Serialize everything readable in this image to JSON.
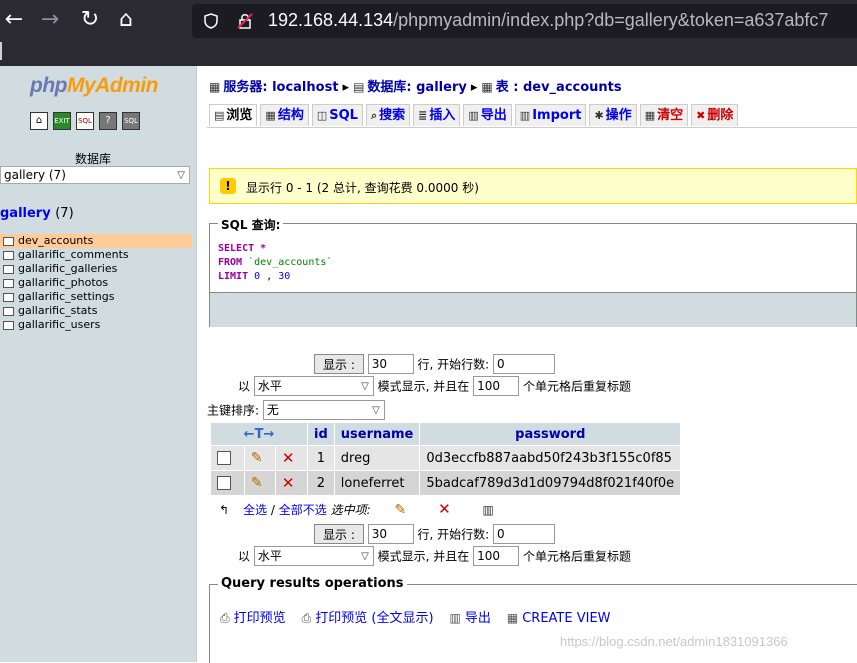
{
  "browser": {
    "back_icon": "←",
    "forward_icon": "→",
    "reload_icon": "↻",
    "home_icon": "⌂",
    "url_host": "192.168.44.134",
    "url_path": "/phpmyadmin/index.php?db=gallery&token=a637abfc7"
  },
  "sidebar": {
    "logo_php": "php",
    "logo_my": "My",
    "logo_admin": "Admin",
    "db_label": "数据库",
    "db_select": "gallery (7)",
    "db_name": "gallery",
    "db_count": "(7)",
    "tables": [
      {
        "name": "dev_accounts",
        "active": true
      },
      {
        "name": "gallarific_comments"
      },
      {
        "name": "gallarific_galleries"
      },
      {
        "name": "gallarific_photos"
      },
      {
        "name": "gallarific_settings"
      },
      {
        "name": "gallarific_stats"
      },
      {
        "name": "gallarific_users"
      }
    ]
  },
  "breadcrumb": {
    "server": "服务器: localhost",
    "database": "数据库: gallery",
    "table": "表 : dev_accounts"
  },
  "tabs": [
    {
      "label": "浏览"
    },
    {
      "label": "结构"
    },
    {
      "label": "SQL"
    },
    {
      "label": "搜索"
    },
    {
      "label": "插入"
    },
    {
      "label": "导出"
    },
    {
      "label": "Import"
    },
    {
      "label": "操作"
    },
    {
      "label": "清空"
    },
    {
      "label": "删除"
    }
  ],
  "notice": "显示行 0 - 1 (2 总计, 查询花费 0.0000 秒)",
  "sql": {
    "legend": "SQL 查询:",
    "select": "SELECT",
    "star": "*",
    "from": "FROM",
    "table": "`dev_accounts`",
    "limit": "LIMIT",
    "offset": "0",
    "comma": ",",
    "count": "30"
  },
  "nav": {
    "show_button": "显示 :",
    "rows": "30",
    "start_label": "行, 开始行数:",
    "start": "0",
    "in_label": "以",
    "mode": "水平",
    "mode_label": "模式显示, 并且在",
    "repeat": "100",
    "repeat_label": "个单元格后重复标题",
    "sort_label": "主键排序:",
    "sort_value": "无"
  },
  "results": {
    "columns": [
      "id",
      "username",
      "password"
    ],
    "arrows": "←T→",
    "rows": [
      {
        "id": "1",
        "username": "dreg",
        "password": "0d3eccfb887aabd50f243b3f155c0f85"
      },
      {
        "id": "2",
        "username": "loneferret",
        "password": "5badcaf789d3d1d09794d8f021f40f0e"
      }
    ]
  },
  "bulk": {
    "select_all": "全选",
    "sep": "/",
    "deselect_all": "全部不选",
    "with_selected": "选中项:"
  },
  "ops": {
    "legend": "Query results operations",
    "links": [
      "打印预览",
      "打印预览 (全文显示)",
      "导出",
      "CREATE VIEW"
    ]
  },
  "watermark": "https://blog.csdn.net/admin1831091366"
}
